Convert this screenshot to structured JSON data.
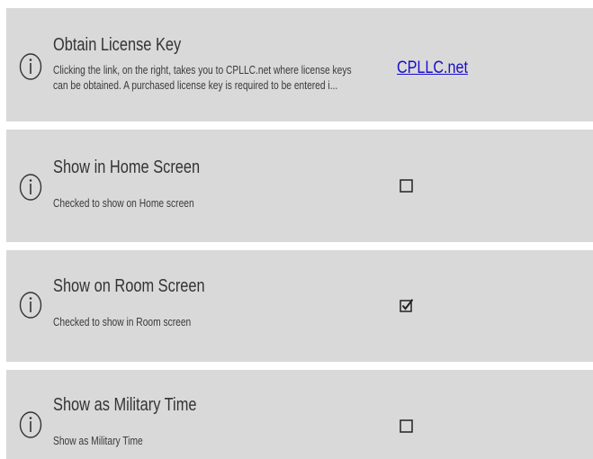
{
  "settings": [
    {
      "title": "Obtain License Key",
      "description_line1": "Clicking the link, on the right, takes you to CPLLC.net where license keys",
      "description_line2": "can be obtained.  A purchased license key is required to be entered i...",
      "link_text": "CPLLC.net"
    },
    {
      "title": "Show in Home Screen",
      "description": "Checked to show on Home screen",
      "checked": false
    },
    {
      "title": "Show on Room Screen",
      "description": "Checked to show in Room screen",
      "checked": true
    },
    {
      "title": "Show as Military Time",
      "description": "Show as Military Time",
      "checked": false
    }
  ],
  "icons": {
    "info": "info-icon",
    "checkbox_unchecked": "checkbox-unchecked-icon",
    "checkbox_checked": "checkbox-checked-icon"
  },
  "colors": {
    "row_background": "#d9d9d9",
    "link": "#1a0dcc",
    "text": "#333333"
  }
}
